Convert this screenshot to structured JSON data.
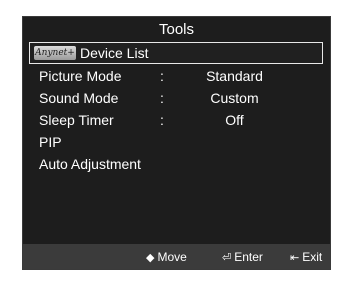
{
  "title": "Tools",
  "selected": {
    "logo_text": "Anynet+",
    "label": "Device List"
  },
  "items": [
    {
      "label": "Picture Mode",
      "separator": ":",
      "value": "Standard"
    },
    {
      "label": "Sound Mode",
      "separator": ":",
      "value": "Custom"
    },
    {
      "label": "Sleep Timer",
      "separator": ":",
      "value": "Off"
    },
    {
      "label": "PIP"
    },
    {
      "label": "Auto Adjustment"
    }
  ],
  "footer": {
    "move_label": "Move",
    "move_icon": "◆",
    "enter_label": "Enter",
    "enter_icon": "⏎",
    "exit_label": "Exit",
    "exit_icon": "⇤"
  }
}
